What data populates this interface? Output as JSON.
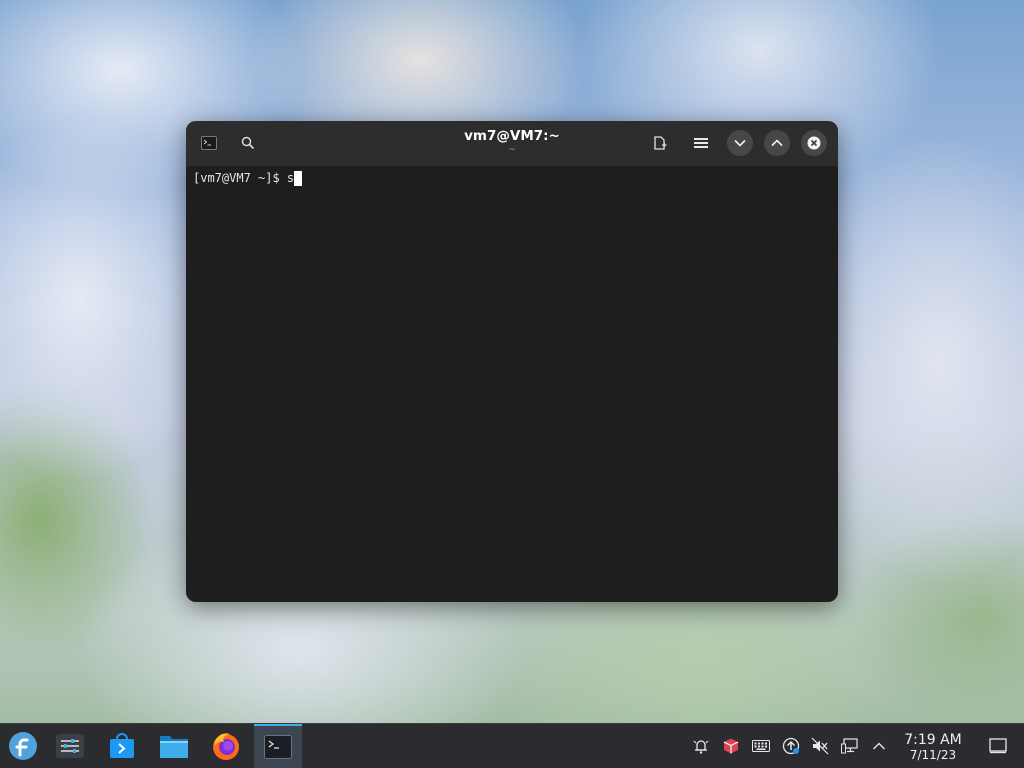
{
  "window": {
    "title": "vm7@VM7:~",
    "subtitle": "~",
    "icons": {
      "app": "terminal-icon",
      "search": "search-icon",
      "new_tab": "new-tab-icon",
      "menu": "hamburger-menu-icon",
      "minimize": "chevron-down-icon",
      "maximize": "chevron-up-icon",
      "close": "close-icon"
    }
  },
  "terminal": {
    "prompt": "[vm7@VM7 ~]$ ",
    "input": "s"
  },
  "taskbar": {
    "apps": [
      {
        "name": "Application Launcher",
        "icon": "fedora-logo-icon"
      },
      {
        "name": "System Settings",
        "icon": "settings-sliders-icon"
      },
      {
        "name": "Discover",
        "icon": "discover-store-icon"
      },
      {
        "name": "Dolphin",
        "icon": "folder-icon"
      },
      {
        "name": "Firefox",
        "icon": "firefox-icon"
      },
      {
        "name": "Konsole",
        "icon": "terminal-icon"
      }
    ],
    "tray": [
      "notifications-icon",
      "package-icon",
      "keyboard-icon",
      "updates-icon",
      "volume-muted-icon",
      "network-icon",
      "show-hidden-chevron-icon"
    ],
    "clock": {
      "time": "7:19 AM",
      "date": "7/11/23"
    },
    "peek_desktop": "show-desktop-icon"
  },
  "colors": {
    "accent": "#3daee9",
    "terminal_bg": "#1e1e1e",
    "titlebar_bg": "#2d2d2d",
    "taskbar_bg": "#2a2c30"
  }
}
